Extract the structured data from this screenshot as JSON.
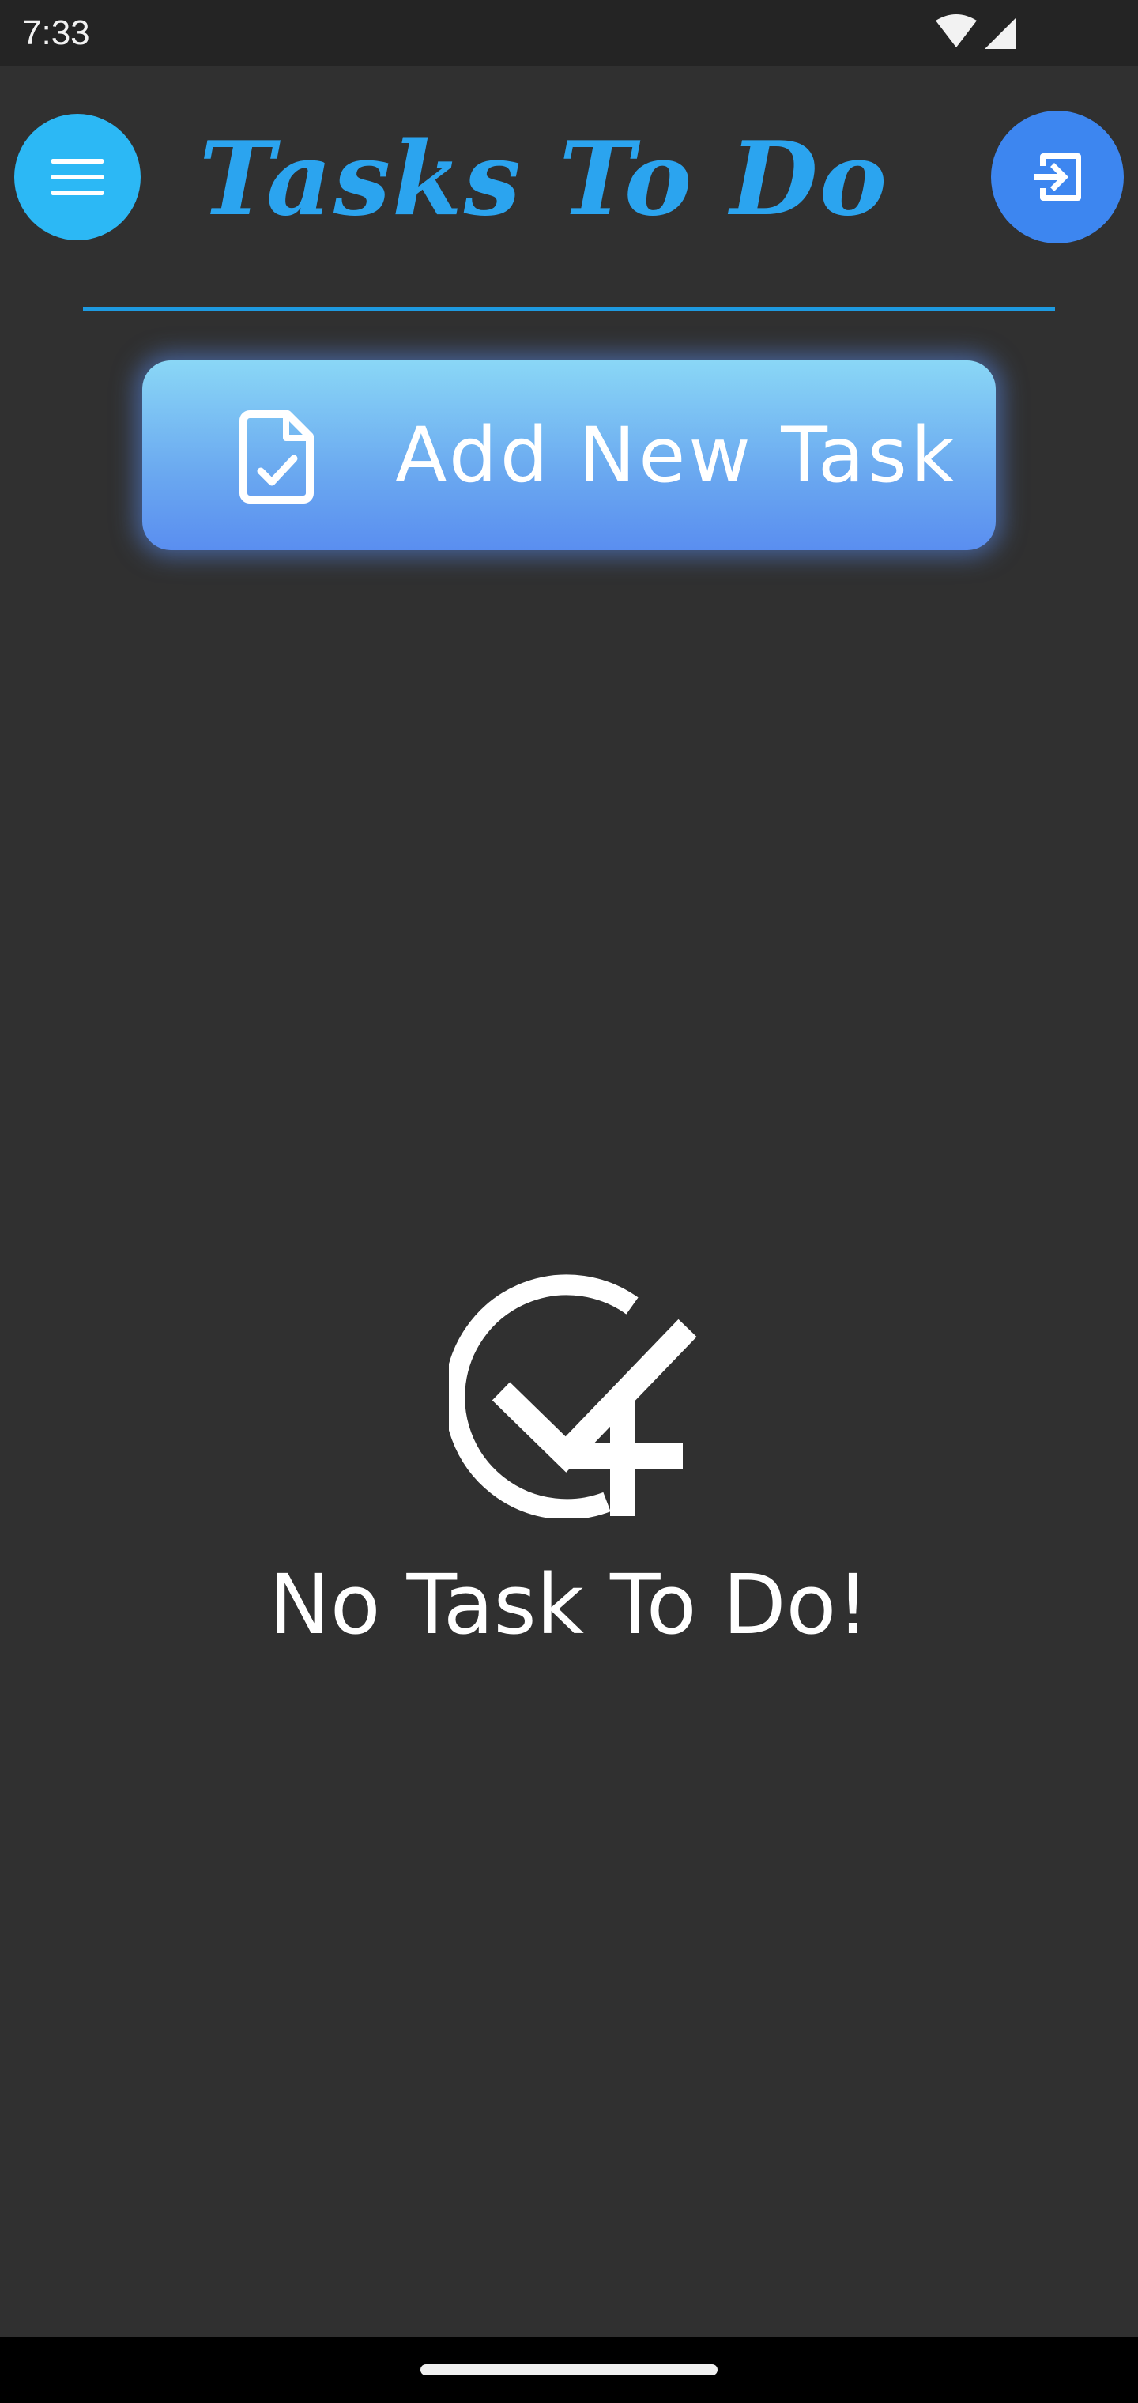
{
  "status_bar": {
    "time": "7:33",
    "wifi_icon": "wifi-icon",
    "signal_icon": "signal-icon"
  },
  "header": {
    "title": "Tasks To Do",
    "menu_icon": "menu-icon",
    "logout_icon": "exit-to-app-icon"
  },
  "add_task": {
    "label": "Add New Task",
    "icon": "task-file-check-icon"
  },
  "empty_state": {
    "icon": "check-circle-plus-icon",
    "message": "No Task To Do!"
  },
  "colors": {
    "background": "#303030",
    "accent_light_blue": "#2cb8f5",
    "accent_blue": "#3d86f0",
    "title_blue": "#2ba4ef",
    "divider": "#1e9ae0"
  }
}
